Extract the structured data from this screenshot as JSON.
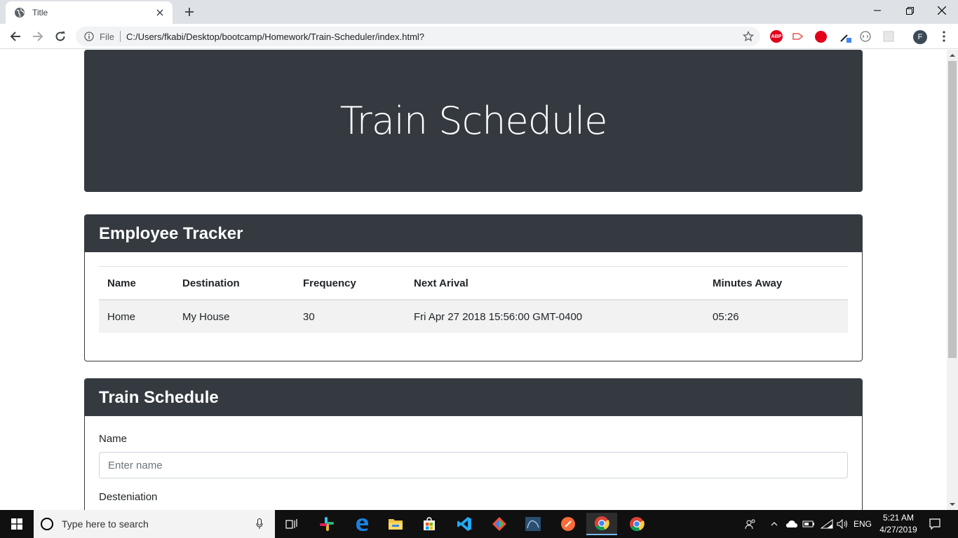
{
  "browser": {
    "tab_title": "Title",
    "address_scheme": "File",
    "address_url": "C:/Users/fkabi/Desktop/bootcamp/Homework/Train-Scheduler/index.html?",
    "profile_initial": "F",
    "abp_label": "ABP"
  },
  "page": {
    "jumbotron_title": "Train Schedule",
    "tracker": {
      "header": "Employee Tracker",
      "columns": [
        "Name",
        "Destination",
        "Frequency",
        "Next Arival",
        "Minutes Away"
      ],
      "rows": [
        [
          "Home",
          "My House",
          "30",
          "Fri Apr 27 2018 15:56:00 GMT-0400",
          "05:26"
        ]
      ]
    },
    "form": {
      "header": "Train Schedule",
      "name_label": "Name",
      "name_placeholder": "Enter name",
      "destination_label": "Desteniation"
    }
  },
  "taskbar": {
    "search_placeholder": "Type here to search",
    "language": "ENG",
    "time": "5:21 AM",
    "date": "4/27/2019"
  },
  "colors": {
    "dark": "#343a40",
    "chrome_tabbar": "#dee1e6",
    "taskbar": "#101010"
  }
}
